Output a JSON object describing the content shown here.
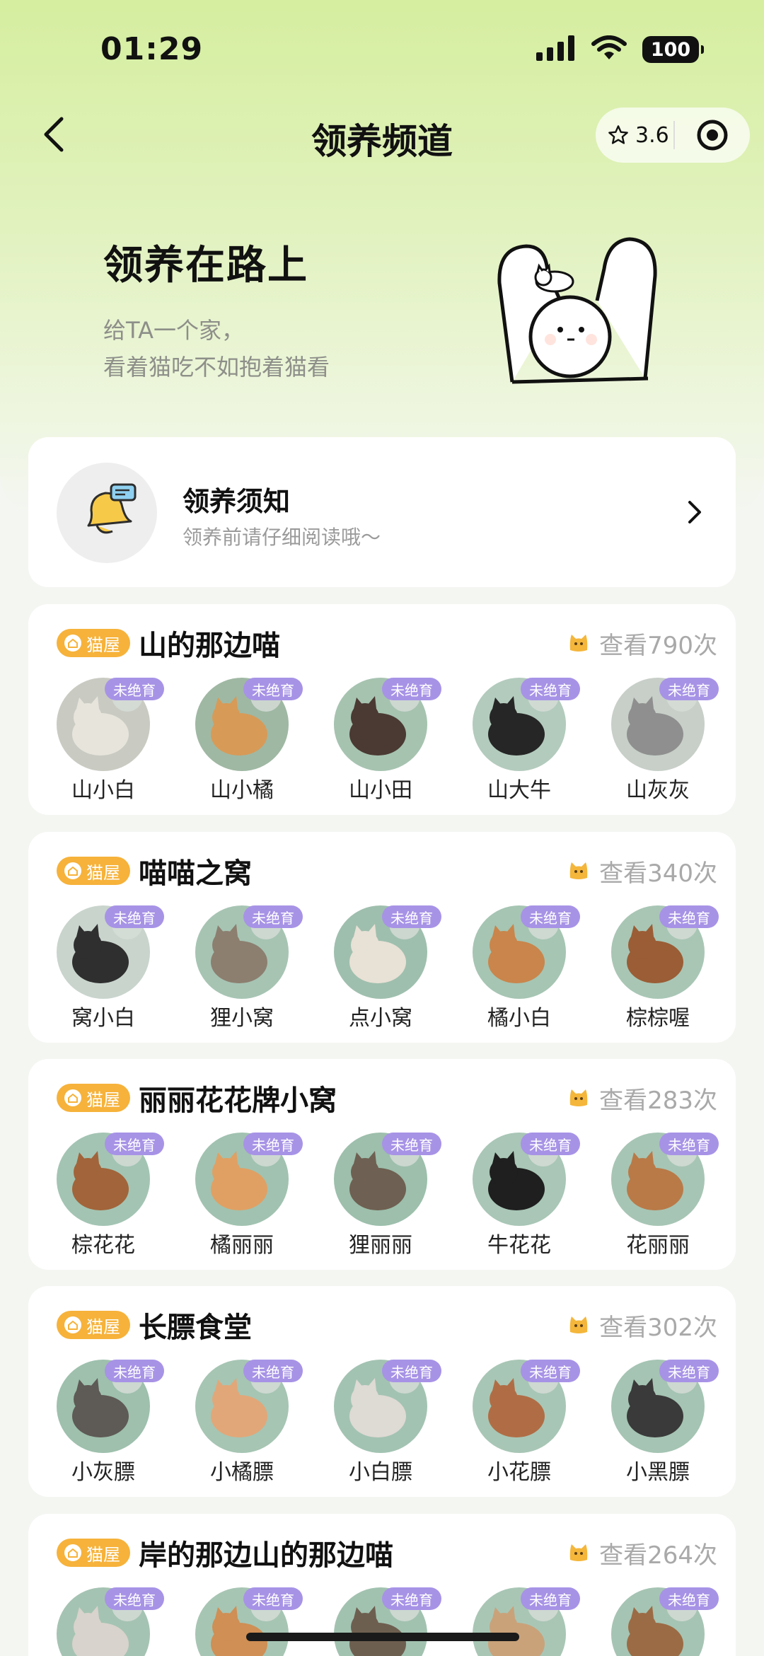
{
  "status": {
    "time": "01:29",
    "battery": "100"
  },
  "nav": {
    "title": "领养频道",
    "rating": "3.6"
  },
  "hero": {
    "title": "领养在路上",
    "subtitle_line1": "给TA一个家，",
    "subtitle_line2": "看着猫吃不如抱着猫看"
  },
  "notice": {
    "title": "领养须知",
    "subtitle": "领养前请仔细阅读哦～"
  },
  "houses": [
    {
      "tag": "猫屋",
      "name": "山的那边喵",
      "views": "查看790次",
      "cats": [
        {
          "name": "山小白",
          "badge": "未绝育",
          "fur": "#e7e4dc",
          "bg": "#c9cbc2"
        },
        {
          "name": "山小橘",
          "badge": "未绝育",
          "fur": "#d89a57",
          "bg": "#9fb8a3"
        },
        {
          "name": "山小田",
          "badge": "未绝育",
          "fur": "#4a3a33",
          "bg": "#a6c3b0"
        },
        {
          "name": "山大牛",
          "badge": "未绝育",
          "fur": "#262626",
          "bg": "#b3cbbd"
        },
        {
          "name": "山灰灰",
          "badge": "未绝育",
          "fur": "#8f8f8f",
          "bg": "#c7cfc8"
        }
      ]
    },
    {
      "tag": "猫屋",
      "name": "喵喵之窝",
      "views": "查看340次",
      "cats": [
        {
          "name": "窝小白",
          "badge": "未绝育",
          "fur": "#2f2f2f",
          "bg": "#c9d4cd"
        },
        {
          "name": "狸小窝",
          "badge": "未绝育",
          "fur": "#8c7f70",
          "bg": "#a7c4b3"
        },
        {
          "name": "点小窝",
          "badge": "未绝育",
          "fur": "#e8e1d6",
          "bg": "#9fbfae"
        },
        {
          "name": "橘小白",
          "badge": "未绝育",
          "fur": "#c9854b",
          "bg": "#a6c5b3"
        },
        {
          "name": "棕棕喔",
          "badge": "未绝育",
          "fur": "#9a5d35",
          "bg": "#a9c6b5"
        }
      ]
    },
    {
      "tag": "猫屋",
      "name": "丽丽花花牌小窝",
      "views": "查看283次",
      "cats": [
        {
          "name": "棕花花",
          "badge": "未绝育",
          "fur": "#a2643a",
          "bg": "#a3c4b3"
        },
        {
          "name": "橘丽丽",
          "badge": "未绝育",
          "fur": "#e0a063",
          "bg": "#a1c2b0"
        },
        {
          "name": "狸丽丽",
          "badge": "未绝育",
          "fur": "#6e6052",
          "bg": "#9dbfac"
        },
        {
          "name": "牛花花",
          "badge": "未绝育",
          "fur": "#1f1f1f",
          "bg": "#a9c6b6"
        },
        {
          "name": "花丽丽",
          "badge": "未绝育",
          "fur": "#b97a48",
          "bg": "#a7c5b4"
        }
      ]
    },
    {
      "tag": "猫屋",
      "name": "长膘食堂",
      "views": "查看302次",
      "cats": [
        {
          "name": "小灰膘",
          "badge": "未绝育",
          "fur": "#5e5a55",
          "bg": "#9ec0ad"
        },
        {
          "name": "小橘膘",
          "badge": "未绝育",
          "fur": "#e2a778",
          "bg": "#a6c5b3"
        },
        {
          "name": "小白膘",
          "badge": "未绝育",
          "fur": "#dedad4",
          "bg": "#a3c3b2"
        },
        {
          "name": "小花膘",
          "badge": "未绝育",
          "fur": "#b06d45",
          "bg": "#a8c6b5"
        },
        {
          "name": "小黑膘",
          "badge": "未绝育",
          "fur": "#3a3a3a",
          "bg": "#a5c4b3"
        }
      ]
    },
    {
      "tag": "猫屋",
      "name": "岸的那边山的那边喵",
      "views": "查看264次",
      "cats": [
        {
          "name": "",
          "badge": "未绝育",
          "fur": "#d8d3cc",
          "bg": "#a5c3b2"
        },
        {
          "name": "",
          "badge": "未绝育",
          "fur": "#cf8f55",
          "bg": "#a7c5b3"
        },
        {
          "name": "",
          "badge": "未绝育",
          "fur": "#6d5f50",
          "bg": "#a2c2b0"
        },
        {
          "name": "",
          "badge": "未绝育",
          "fur": "#c9a27a",
          "bg": "#a9c6b5"
        },
        {
          "name": "",
          "badge": "未绝育",
          "fur": "#9b6b45",
          "bg": "#a6c4b3"
        }
      ]
    }
  ]
}
